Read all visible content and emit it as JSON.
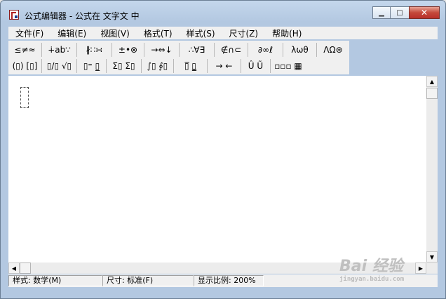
{
  "window": {
    "title": "公式编辑器 - 公式在 文字文 中"
  },
  "winbtns": {
    "minimize": "▁",
    "maximize": "□",
    "close": "✕"
  },
  "menu": [
    "文件(F)",
    "编辑(E)",
    "视图(V)",
    "格式(T)",
    "样式(S)",
    "尺寸(Z)",
    "帮助(H)"
  ],
  "toolbar": {
    "row1": [
      "≤≠≈",
      "∔ab∵",
      "∦∷∺",
      "±•⊗",
      "→⇔↓",
      "∴∀∃",
      "∉∩⊂",
      "∂∞ℓ",
      "λωθ",
      "ΛΩ⊛"
    ],
    "row2": [
      "(▯) [▯]",
      "▯/▯ √▯",
      "▯⁼ ▯̲",
      "Σ▯ Σ▯",
      "∫▯ ∮▯",
      "▯̅ ▯̳",
      "→ ←",
      "Û Ũ",
      "▫▫▫ ▦"
    ]
  },
  "scroll": {
    "up": "▲",
    "down": "▼",
    "left": "◀",
    "right": "▶"
  },
  "status": {
    "style": "样式: 数学(M)",
    "size": "尺寸: 标准(F)",
    "zoom": "显示比例: 200%"
  },
  "watermark": {
    "brand": "Bai 经验",
    "url": "jingyan.baidu.com"
  }
}
